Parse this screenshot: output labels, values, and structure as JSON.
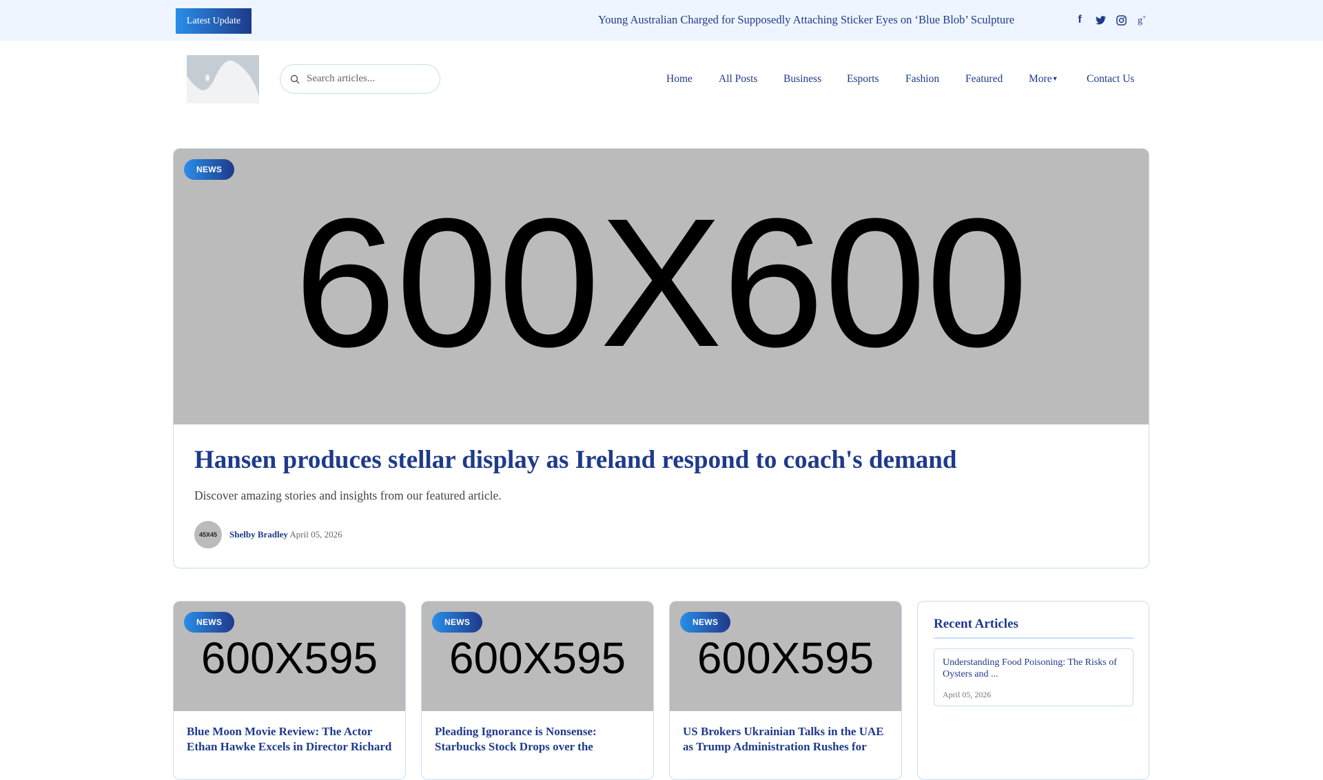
{
  "topbar": {
    "latest_label": "Latest Update",
    "ticker": "Young Australian Charged for Supposedly Attaching Sticker Eyes on ‘Blue Blob’ Sculpture",
    "social": [
      "facebook-icon",
      "twitter-icon",
      "instagram-icon",
      "google-plus-icon"
    ]
  },
  "search": {
    "placeholder": "Search articles..."
  },
  "nav": {
    "items": [
      "Home",
      "All Posts",
      "Business",
      "Esports",
      "Fashion",
      "Featured",
      "More",
      "Contact Us"
    ]
  },
  "hero": {
    "badge": "NEWS",
    "image_text": "600X600",
    "title": "Hansen produces stellar display as Ireland respond to coach's demand",
    "description": "Discover amazing stories and insights from our featured article.",
    "avatar_text": "45X45",
    "author": "Shelby Bradley",
    "date": "April 05, 2026"
  },
  "cards": [
    {
      "badge": "NEWS",
      "image_text": "600X595",
      "title": "Blue Moon Movie Review: The Actor Ethan Hawke Excels in Director Richard"
    },
    {
      "badge": "NEWS",
      "image_text": "600X595",
      "title": "Pleading Ignorance is Nonsense: Starbucks Stock Drops over the"
    },
    {
      "badge": "NEWS",
      "image_text": "600X595",
      "title": "US Brokers Ukrainian Talks in the UAE as Trump Administration Rushes for"
    }
  ],
  "sidebar": {
    "title": "Recent Articles",
    "items": [
      {
        "title": "Understanding Food Poisoning: The Risks of Oysters and ...",
        "date": "April 05, 2026"
      }
    ]
  },
  "colors": {
    "accent": "#1e3a8a",
    "accent_light": "#2a8ee8",
    "topbar_bg": "#eef5fe",
    "placeholder_bg": "#bbbbbb"
  }
}
